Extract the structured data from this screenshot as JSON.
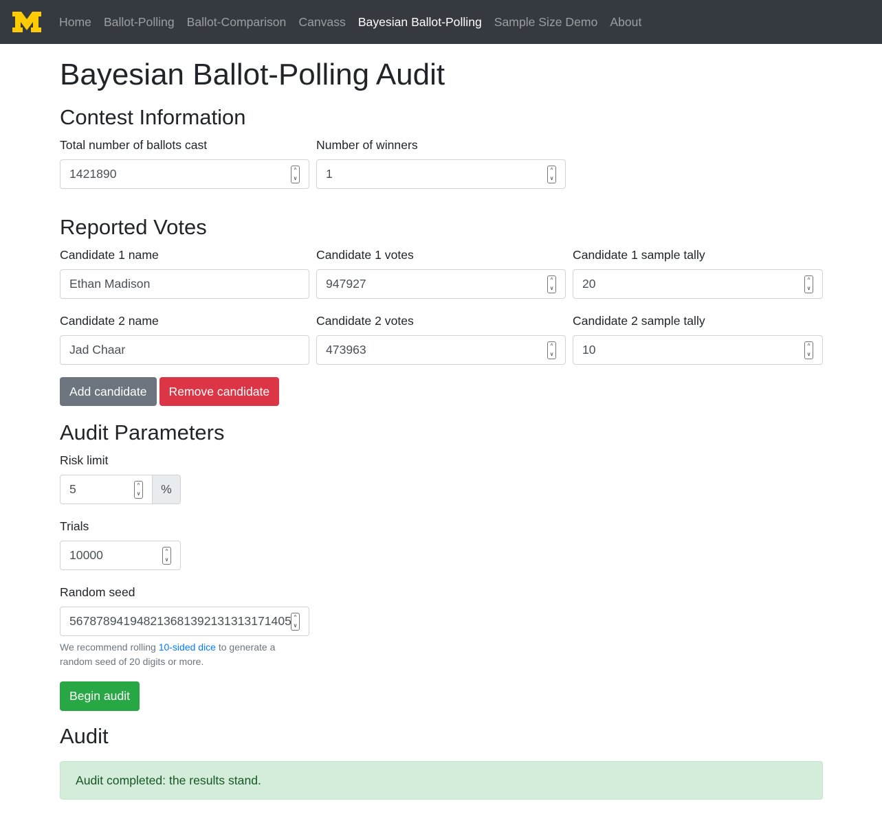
{
  "nav": {
    "brand_icon": "michigan-block-m-logo",
    "brand_color": "#ffcb05",
    "items": [
      {
        "label": "Home",
        "active": false
      },
      {
        "label": "Ballot-Polling",
        "active": false
      },
      {
        "label": "Ballot-Comparison",
        "active": false
      },
      {
        "label": "Canvass",
        "active": false
      },
      {
        "label": "Bayesian Ballot-Polling",
        "active": true
      },
      {
        "label": "Sample Size Demo",
        "active": false
      },
      {
        "label": "About",
        "active": false
      }
    ]
  },
  "page_title": "Bayesian Ballot-Polling Audit",
  "contest": {
    "heading": "Contest Information",
    "ballots_label": "Total number of ballots cast",
    "ballots_value": "1421890",
    "winners_label": "Number of winners",
    "winners_value": "1"
  },
  "reported": {
    "heading": "Reported Votes",
    "candidates": [
      {
        "name_label": "Candidate 1 name",
        "name_value": "Ethan Madison",
        "votes_label": "Candidate 1 votes",
        "votes_value": "947927",
        "tally_label": "Candidate 1 sample tally",
        "tally_value": "20"
      },
      {
        "name_label": "Candidate 2 name",
        "name_value": "Jad Chaar",
        "votes_label": "Candidate 2 votes",
        "votes_value": "473963",
        "tally_label": "Candidate 2 sample tally",
        "tally_value": "10"
      }
    ],
    "add_label": "Add candidate",
    "remove_label": "Remove candidate"
  },
  "params": {
    "heading": "Audit Parameters",
    "risk_label": "Risk limit",
    "risk_value": "5",
    "risk_unit": "%",
    "trials_label": "Trials",
    "trials_value": "10000",
    "seed_label": "Random seed",
    "seed_value": "567878941948213681392131313171405",
    "help_prefix": "We recommend rolling ",
    "help_link": "10-sided dice",
    "help_suffix": " to generate a random seed of 20 digits or more.",
    "begin_label": "Begin audit"
  },
  "audit": {
    "heading": "Audit",
    "result": "Audit completed: the results stand."
  },
  "colors": {
    "navbar_bg": "#343a40",
    "secondary": "#6c757d",
    "danger": "#dc3545",
    "success": "#28a745",
    "link": "#007bff",
    "alert_bg": "#d4edda",
    "alert_text": "#155724"
  }
}
